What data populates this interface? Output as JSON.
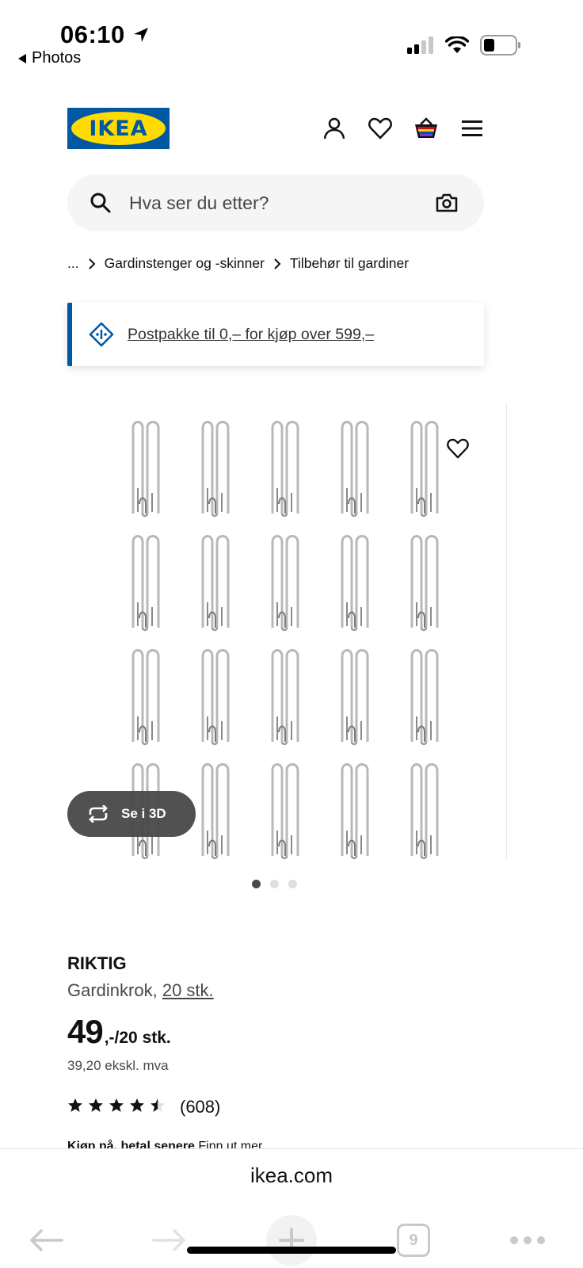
{
  "status_bar": {
    "time": "06:10",
    "back_app_label": "Photos"
  },
  "header": {
    "logo_text": "IKEA",
    "colors": {
      "brand_blue": "#0058a3",
      "brand_yellow": "#ffdb00"
    }
  },
  "search": {
    "placeholder": "Hva ser du etter?"
  },
  "breadcrumb": {
    "items": [
      "...",
      "Gardinstenger og -skinner",
      "Tilbehør til gardiner"
    ]
  },
  "banner": {
    "text": "Postpakke til 0,– for kjøp over 599,–"
  },
  "gallery": {
    "button_3d_label": "Se i 3D",
    "dots_total": 3,
    "dots_active": 1
  },
  "product": {
    "name": "RIKTIG",
    "description": "Gardinkrok, ",
    "quantity_link": "20 stk.",
    "price_main": "49",
    "price_suffix": ",-/20 stk.",
    "price_ex_vat": "39,20 ekskl. mva",
    "rating_value": 4.5,
    "rating_count": "(608)",
    "klarna_bold": "Kjøp nå, betal senere",
    "klarna_link": " Finn ut mer"
  },
  "browser": {
    "url": "ikea.com",
    "tab_count": "9"
  }
}
